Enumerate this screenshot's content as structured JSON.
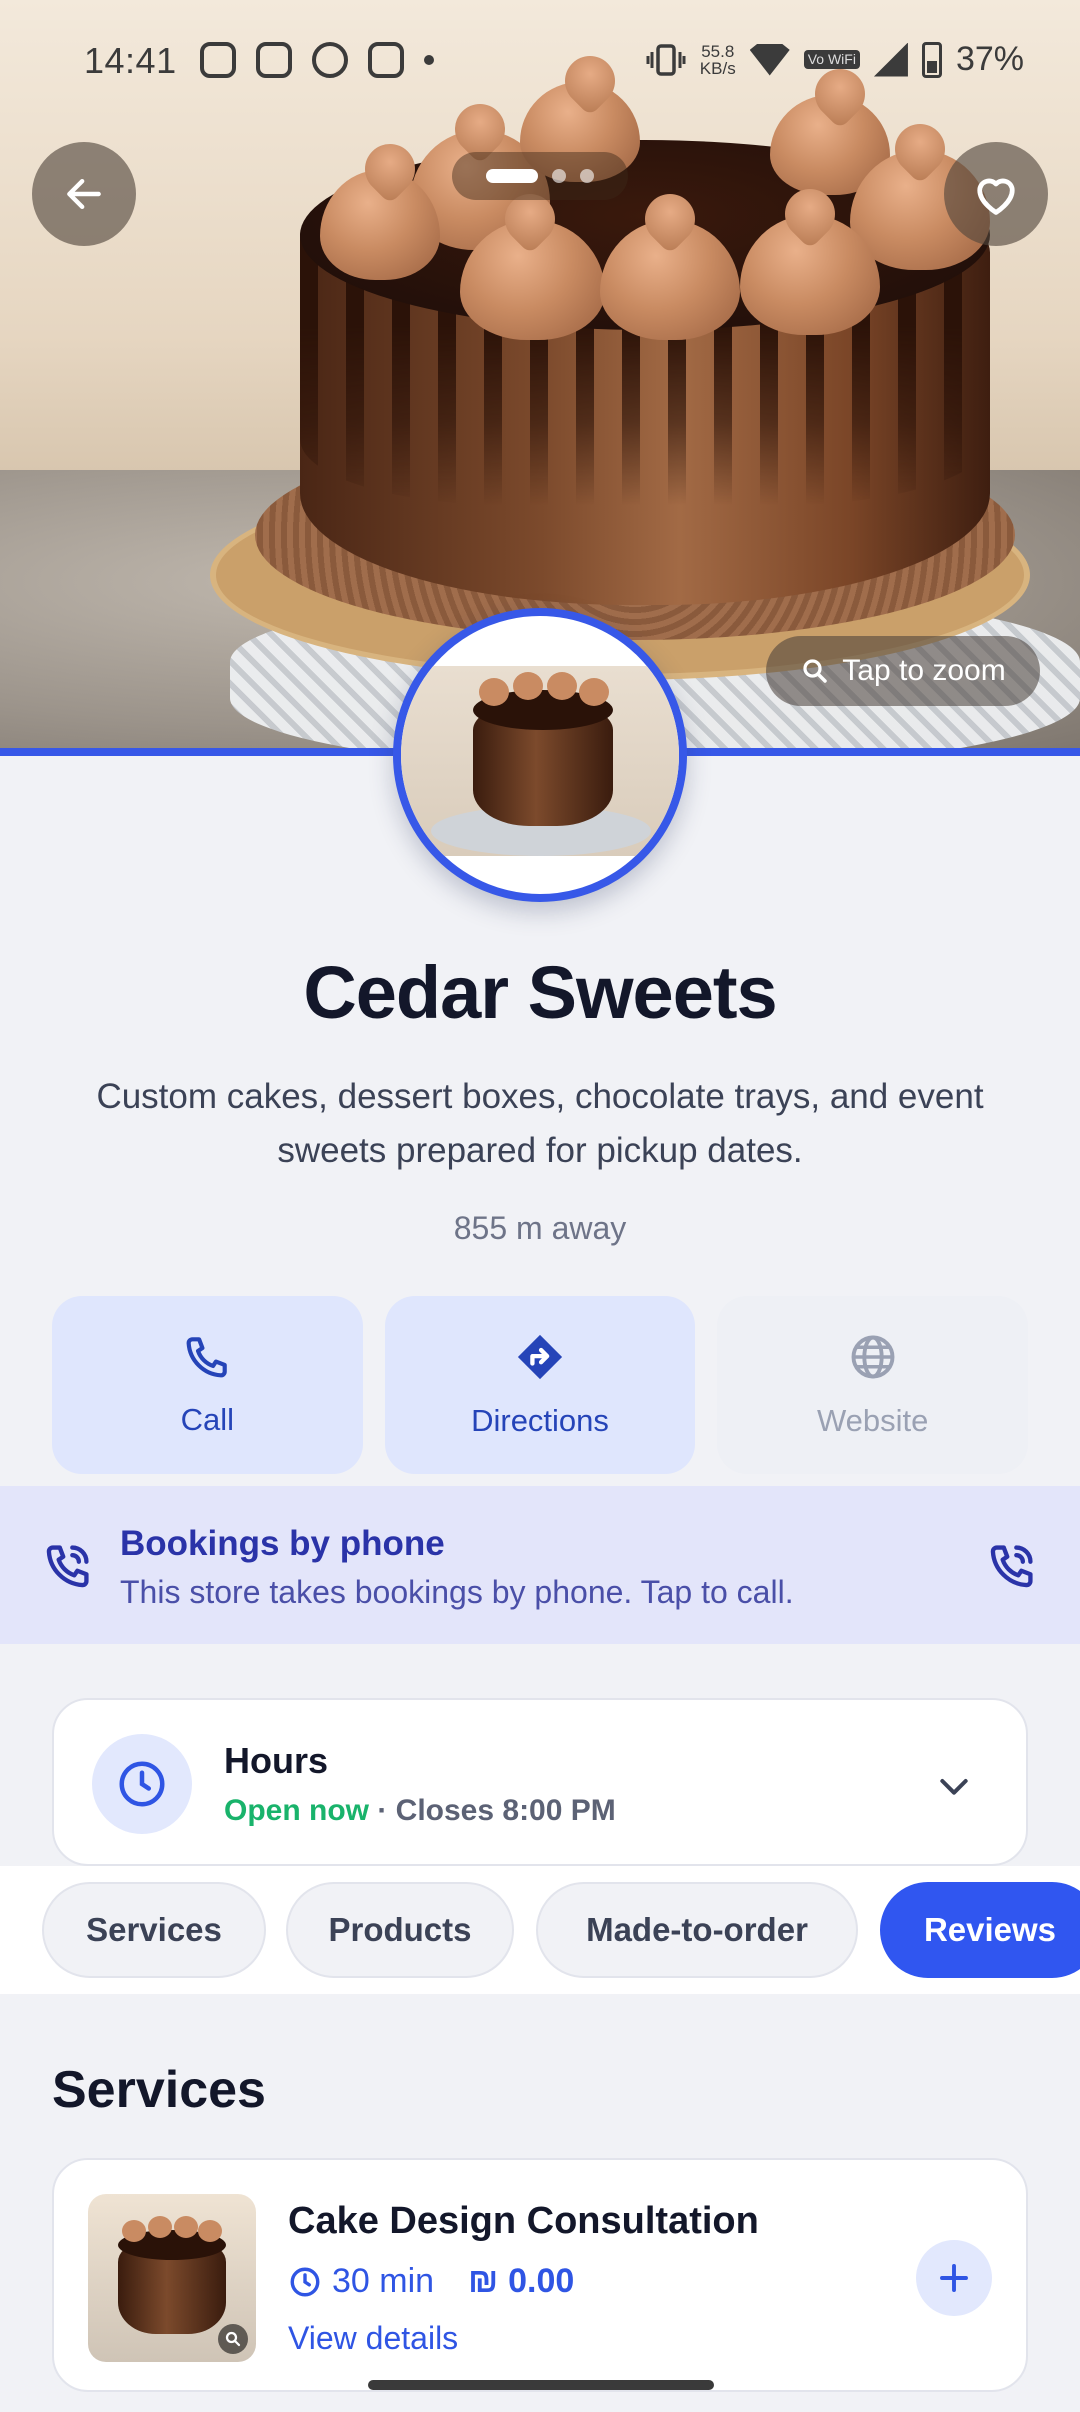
{
  "status_bar": {
    "time": "14:41",
    "net_speed": "55.8",
    "net_unit": "KB/s",
    "volte": "Vo WiFi",
    "battery": "37%"
  },
  "hero": {
    "page_count": 3,
    "active_page": 1,
    "zoom_label": "Tap to zoom"
  },
  "store": {
    "name": "Cedar Sweets",
    "description": "Custom cakes, dessert boxes, chocolate trays, and event sweets prepared for pickup dates.",
    "distance": "855 m away"
  },
  "actions": {
    "call": "Call",
    "directions": "Directions",
    "website": "Website"
  },
  "notice": {
    "title": "Bookings by phone",
    "subtitle": "This store takes bookings by phone. Tap to call."
  },
  "hours": {
    "title": "Hours",
    "open_status": "Open now",
    "closes": "· Closes 8:00 PM"
  },
  "tabs": [
    {
      "label": "Services"
    },
    {
      "label": "Products"
    },
    {
      "label": "Made-to-order"
    },
    {
      "label": "Reviews",
      "active": true
    }
  ],
  "services": {
    "section_title": "Services",
    "items": [
      {
        "name": "Cake Design Consultation",
        "duration": "30 min",
        "price": "0.00",
        "currency_symbol": "₪",
        "details_link": "View details"
      }
    ]
  },
  "colors": {
    "accent": "#3758e8",
    "open_green": "#19b36b",
    "notice_bg": "#e3e5fa"
  }
}
